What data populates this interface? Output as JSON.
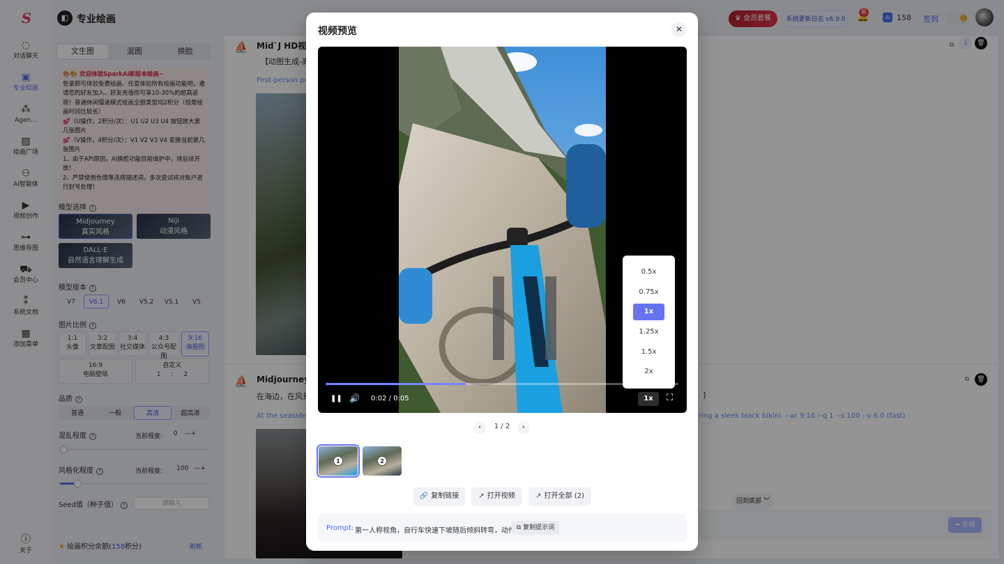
{
  "app": {
    "logo_text": "S",
    "title": "专业绘画"
  },
  "nav": {
    "items": [
      {
        "label": "对话聊天",
        "icon": "chat-icon",
        "glyph": "◌"
      },
      {
        "label": "专业绘画",
        "icon": "paint-icon",
        "glyph": "▣"
      },
      {
        "label": "Agen...",
        "icon": "agent-icon",
        "glyph": "⁂"
      },
      {
        "label": "绘画广场",
        "icon": "gallery-icon",
        "glyph": "▨"
      },
      {
        "label": "AI智能体",
        "icon": "ai-agent-icon",
        "glyph": "⚇"
      },
      {
        "label": "视频创作",
        "icon": "video-icon",
        "glyph": "▶"
      },
      {
        "label": "思维导图",
        "icon": "mindmap-icon",
        "glyph": "⊶"
      },
      {
        "label": "会员中心",
        "icon": "cart-icon",
        "glyph": "⛟"
      },
      {
        "label": "系统文档",
        "icon": "docs-icon",
        "glyph": "⁑"
      },
      {
        "label": "添加菜单",
        "icon": "grid-icon",
        "glyph": "▦"
      }
    ],
    "about_label": "关于"
  },
  "header": {
    "vip_label": "会员套餐",
    "update_label": "系统更新日志 v6.9.0",
    "bell_badge": "新",
    "points_icon_text": "AI",
    "points": "158",
    "checkin_label": "签到"
  },
  "panel": {
    "tabs": [
      "文生图",
      "混图",
      "换脸"
    ],
    "notice": {
      "title": "🎨🎨 欢迎体验SparkAi新版本绘画~",
      "lines": [
        "登录即可体验免费绘画、任意体验所有绘画功能吧，邀请您的好友加入、好友充值你可享10-30%的超高返现！普通休闲慢速模式绘画全部类型均2积分（但是绘画时间比较长）",
        "💕（U操作，2积分/次）：U1 U2 U3 U4 按钮放大第几张图片",
        "💕（V操作，4积分/次）：V1 V2 V3 V4 变换当前第几张图片",
        "1、由于API原因，AI换脸功能目前维护中，待后续开放！",
        "2、严禁使用色情等违规描述词，多次尝试将对账户进行封号处理！"
      ]
    },
    "model_label": "模型选择",
    "models": [
      {
        "name": "Midjourney",
        "sub": "真实风格"
      },
      {
        "name": "Niji",
        "sub": "动漫风格"
      },
      {
        "name": "DALL·E",
        "sub": "自然语言理解生成"
      }
    ],
    "version_label": "模型版本",
    "versions": [
      "V7",
      "V6.1",
      "V6",
      "V5.2",
      "V5.1",
      "V5"
    ],
    "ratio_label": "图片比例",
    "ratios": [
      {
        "value": "1:1",
        "name": "头像"
      },
      {
        "value": "3:2",
        "name": "文章配图"
      },
      {
        "value": "3:4",
        "name": "社交媒体"
      },
      {
        "value": "4:3",
        "name": "公众号配图"
      },
      {
        "value": "9:16",
        "name": "海报图"
      },
      {
        "value": "16:9",
        "name": "电脑壁纸"
      }
    ],
    "custom_label": "自定义",
    "custom_w": "1",
    "custom_sep": ":",
    "custom_h": "2",
    "quality_label": "品质",
    "qualities": [
      "普通",
      "一般",
      "高清",
      "超高清"
    ],
    "chaos_label": "混乱程度",
    "current_level_label": "当前程度:",
    "chaos_value": "0",
    "stylize_label": "风格化程度",
    "stylize_value": "100",
    "seed_label": "Seed值（种子值）",
    "seed_placeholder": "请输入",
    "footer_prefix": "绘画积分余额(",
    "footer_points": "158",
    "footer_suffix": "积分)",
    "refresh_label": "刷新"
  },
  "chat": {
    "messages": [
      {
        "title": "Mid`J HD视频",
        "text": "【动图生成-高速",
        "prompt": "First-person pe"
      },
      {
        "title": "Midjourney B",
        "text": "在海边，在风景如",
        "text_tail": "]",
        "prompt": "At the seaside,",
        "prompt_tail": "ring a sleek black bikini. --ar 9:16 --q 1 --s 100 --v 6.0  (fast)"
      }
    ],
    "back_bottom": "回到底部 ︾",
    "generate_label": "生成"
  },
  "modal": {
    "title": "视频预览",
    "time": "0:02 / 0:05",
    "progress": 0.4,
    "speed_current": "1x",
    "speeds": [
      "0.5x",
      "0.75x",
      "1x",
      "1.25x",
      "1.5x",
      "2x"
    ],
    "pager": "1 / 2",
    "thumbs": [
      "1",
      "2"
    ],
    "actions": {
      "copy_link": "复制链接",
      "open_video": "打开视频",
      "open_all": "打开全部 (2)"
    },
    "prompt_label": "Prompt:",
    "prompt_text": "第一人称视角，自行车快速下坡随后倾斜转弯，动作大",
    "copy_prompt": "复制提示词"
  }
}
